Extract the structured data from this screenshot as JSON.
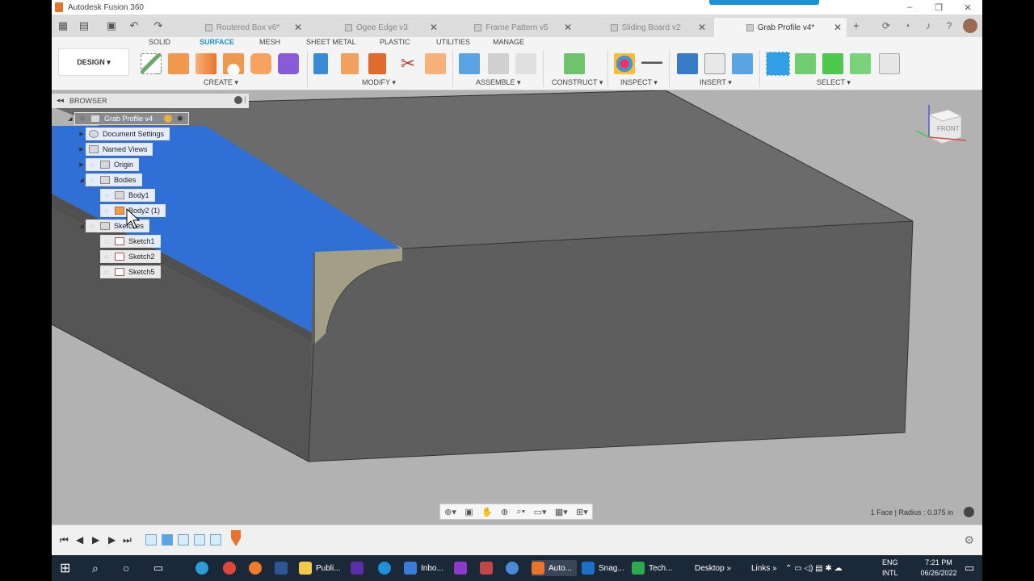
{
  "window": {
    "title": "Autodesk Fusion 360"
  },
  "tabs": [
    {
      "label": "Routered Box v6*"
    },
    {
      "label": "Ogee Edge v3"
    },
    {
      "label": "Frame Pattern v5"
    },
    {
      "label": "Sliding Board v2"
    },
    {
      "label": "Grab Profile v4*",
      "active": true
    }
  ],
  "ribbon": {
    "workspace": "DESIGN",
    "tabs": [
      "SOLID",
      "SURFACE",
      "MESH",
      "SHEET METAL",
      "PLASTIC",
      "UTILITIES",
      "MANAGE"
    ],
    "active_tab": "SURFACE",
    "groups": [
      "CREATE",
      "MODIFY",
      "ASSEMBLE",
      "CONSTRUCT",
      "INSPECT",
      "INSERT",
      "SELECT"
    ]
  },
  "browser": {
    "title": "BROWSER",
    "root": "Grab Profile v4",
    "items": [
      {
        "label": "Document Settings"
      },
      {
        "label": "Named Views"
      },
      {
        "label": "Origin"
      },
      {
        "label": "Bodies"
      },
      {
        "label": "Body1"
      },
      {
        "label": "Body2 (1)"
      },
      {
        "label": "Sketches"
      },
      {
        "label": "Sketch1"
      },
      {
        "label": "Sketch2"
      },
      {
        "label": "Sketch5"
      }
    ]
  },
  "viewcube": {
    "label": "FRONT"
  },
  "status": "1 Face | Radius : 0.375 in",
  "taskbar": {
    "apps": [
      "Publi...",
      "Inbo...",
      "Auto...",
      "Snag...",
      "Tech..."
    ],
    "toolbars": [
      "Desktop",
      "Links"
    ],
    "language": [
      "ENG",
      "INTL"
    ],
    "time": "7:21 PM",
    "date": "06/26/2022"
  },
  "colors": {
    "accent": "#1b8fd8",
    "selection": "#2f6fd6",
    "body": "#5e5e5e",
    "profile": "#a39f86"
  }
}
